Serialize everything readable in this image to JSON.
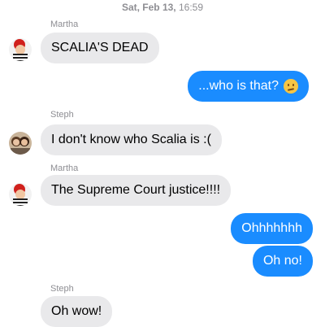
{
  "timestamp": {
    "day": "Sat, Feb 13,",
    "time": "16:59"
  },
  "messages": [
    {
      "sender": "Martha",
      "text": "SCALIA'S DEAD",
      "direction": "incoming"
    },
    {
      "text": "...who is that?",
      "emoji": "confused-face",
      "direction": "outgoing"
    },
    {
      "sender": "Steph",
      "text": "I don't know who Scalia is :(",
      "direction": "incoming"
    },
    {
      "sender": "Martha",
      "text": "The Supreme Court justice!!!!",
      "direction": "incoming"
    },
    {
      "text": "Ohhhhhhh",
      "direction": "outgoing"
    },
    {
      "text": "Oh no!",
      "direction": "outgoing"
    },
    {
      "sender": "Steph",
      "text": "Oh wow!",
      "direction": "incoming"
    }
  ],
  "colors": {
    "outgoing": "#1a8cff",
    "incoming": "#e9e9eb",
    "meta": "#8e8e93"
  }
}
